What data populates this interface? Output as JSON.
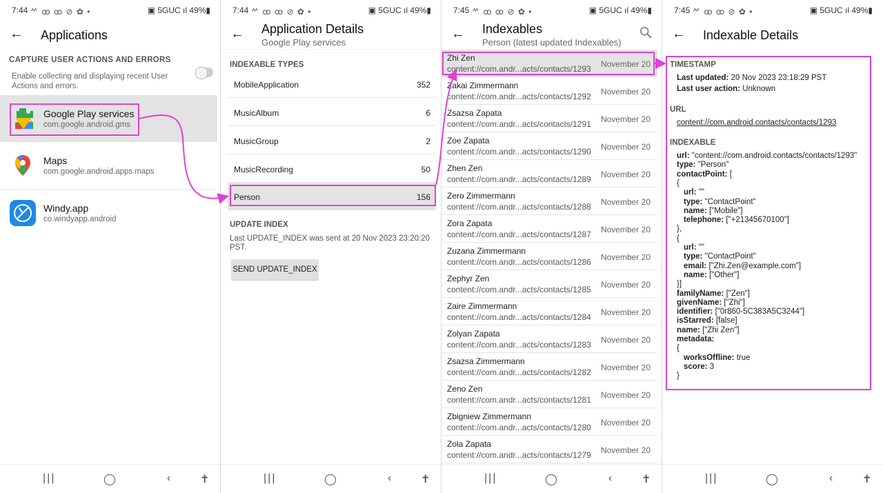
{
  "status_bar": [
    {
      "time": "7:44",
      "icons": "ᄽ ꝏ ꝏ ⊘ ✿ •",
      "right": "▣ 5GUC ıl 49%▮"
    },
    {
      "time": "7:44",
      "icons": "ᄽ ꝏ ꝏ ⊘ ✿ •",
      "right": "▣ 5GUC ıl 49%▮"
    },
    {
      "time": "7:45",
      "icons": "ᄽ ꝏ ꝏ ⊘ ✿ •",
      "right": "▣ 5GUC ıl 49%▮"
    },
    {
      "time": "7:45",
      "icons": "ᄽ ꝏ ꝏ ⊘ ✿ •",
      "right": "▣ 5GUC ıl 49%▮"
    }
  ],
  "nav_icons": {
    "recents": "|||",
    "home": "◯",
    "back": "‹",
    "accessibility": "✝"
  },
  "applications": {
    "title": "Applications",
    "capture_heading": "CAPTURE USER ACTIONS AND ERRORS",
    "capture_desc": "Enable collecting and displaying recent User Actions and errors.",
    "toggle_on": false,
    "apps": [
      {
        "name": "Google Play services",
        "package": "com.google.android.gms"
      },
      {
        "name": "Maps",
        "package": "com.google.android.apps.maps"
      },
      {
        "name": "Windy.app",
        "package": "co.windyapp.android"
      }
    ]
  },
  "app_details": {
    "title": "Application Details",
    "subtitle": "Google Play services",
    "types_heading": "INDEXABLE TYPES",
    "types": [
      {
        "label": "MobileApplication",
        "count": "352"
      },
      {
        "label": "MusicAlbum",
        "count": "6"
      },
      {
        "label": "MusicGroup",
        "count": "2"
      },
      {
        "label": "MusicRecording",
        "count": "50"
      },
      {
        "label": "Person",
        "count": "156"
      }
    ],
    "update_heading": "UPDATE INDEX",
    "update_text": "Last UPDATE_INDEX was sent at 20 Nov 2023 23:20:20 PST.",
    "send_button": "SEND UPDATE_INDEX"
  },
  "indexables": {
    "title": "Indexables",
    "subtitle": "Person (latest updated Indexables)",
    "items": [
      {
        "name": "Zhi Zen",
        "uri": "content://com.andr...acts/contacts/1293",
        "date": "November 20"
      },
      {
        "name": "Zakai Zimmermann",
        "uri": "content://com.andr...acts/contacts/1292",
        "date": "November 20"
      },
      {
        "name": "Zsazsa Zapata",
        "uri": "content://com.andr...acts/contacts/1291",
        "date": "November 20"
      },
      {
        "name": "Zoe Zapata",
        "uri": "content://com.andr...acts/contacts/1290",
        "date": "November 20"
      },
      {
        "name": "Zhen Zen",
        "uri": "content://com.andr...acts/contacts/1289",
        "date": "November 20"
      },
      {
        "name": "Zero Zimmermann",
        "uri": "content://com.andr...acts/contacts/1288",
        "date": "November 20"
      },
      {
        "name": "Zora Zapata",
        "uri": "content://com.andr...acts/contacts/1287",
        "date": "November 20"
      },
      {
        "name": "Zuzana Zimmermann",
        "uri": "content://com.andr...acts/contacts/1286",
        "date": "November 20"
      },
      {
        "name": "Zephyr Zen",
        "uri": "content://com.andr...acts/contacts/1285",
        "date": "November 20"
      },
      {
        "name": "Zaire Zimmermann",
        "uri": "content://com.andr...acts/contacts/1284",
        "date": "November 20"
      },
      {
        "name": "Zolyan Zapata",
        "uri": "content://com.andr...acts/contacts/1283",
        "date": "November 20"
      },
      {
        "name": "Zsazsa Zimmermann",
        "uri": "content://com.andr...acts/contacts/1282",
        "date": "November 20"
      },
      {
        "name": "Zeno Zen",
        "uri": "content://com.andr...acts/contacts/1281",
        "date": "November 20"
      },
      {
        "name": "Zbigniew Zimmermann",
        "uri": "content://com.andr...acts/contacts/1280",
        "date": "November 20"
      },
      {
        "name": "Zola Zapata",
        "uri": "content://com.andr...acts/contacts/1279",
        "date": "November 20"
      }
    ]
  },
  "details": {
    "title": "Indexable Details",
    "timestamp_heading": "TIMESTAMP",
    "last_updated_label": "Last updated:",
    "last_updated_value": "20 Nov 2023 23:18:29 PST",
    "last_action_label": "Last user action:",
    "last_action_value": "Unknown",
    "url_heading": "URL",
    "url": "content://com.android.contacts/contacts/1293",
    "indexable_heading": "INDEXABLE",
    "lines": [
      {
        "k": "url:",
        "v": "\"content://com.android.contacts/contacts/1293\"",
        "indent": 0
      },
      {
        "k": "type:",
        "v": "\"Person\"",
        "indent": 0
      },
      {
        "k": "contactPoint:",
        "v": "[",
        "indent": 0
      },
      {
        "k": "",
        "v": "{",
        "indent": 0
      },
      {
        "k": "url:",
        "v": "\"\"",
        "indent": 1
      },
      {
        "k": "type:",
        "v": "\"ContactPoint\"",
        "indent": 1
      },
      {
        "k": "name:",
        "v": "[\"Mobile\"]",
        "indent": 1
      },
      {
        "k": "telephone:",
        "v": "[\"+21345670100\"]",
        "indent": 1
      },
      {
        "k": "",
        "v": "},",
        "indent": 0
      },
      {
        "k": "",
        "v": "{",
        "indent": 0
      },
      {
        "k": "url:",
        "v": "\"\"",
        "indent": 1
      },
      {
        "k": "type:",
        "v": "\"ContactPoint\"",
        "indent": 1
      },
      {
        "k": "email:",
        "v": "[\"Zhi.Zen@example.com\"]",
        "indent": 1
      },
      {
        "k": "name:",
        "v": "[\"Other\"]",
        "indent": 1
      },
      {
        "k": "",
        "v": "}]",
        "indent": 0
      },
      {
        "k": "familyName:",
        "v": "[\"Zen\"]",
        "indent": 0
      },
      {
        "k": "givenName:",
        "v": "[\"Zhi\"]",
        "indent": 0
      },
      {
        "k": "identifier:",
        "v": "[\"0r860-5C383A5C3244\"]",
        "indent": 0
      },
      {
        "k": "isStarred:",
        "v": "[false]",
        "indent": 0
      },
      {
        "k": "name:",
        "v": "[\"Zhi Zen\"]",
        "indent": 0
      },
      {
        "k": "metadata:",
        "v": "",
        "indent": 0
      },
      {
        "k": "",
        "v": "{",
        "indent": 0
      },
      {
        "k": "worksOffline:",
        "v": "true",
        "indent": 1
      },
      {
        "k": "score:",
        "v": "3",
        "indent": 1
      },
      {
        "k": "",
        "v": "}",
        "indent": 0
      }
    ]
  },
  "colors": {
    "highlight": "#e040d8",
    "selected_row": "#e3e3e3"
  }
}
